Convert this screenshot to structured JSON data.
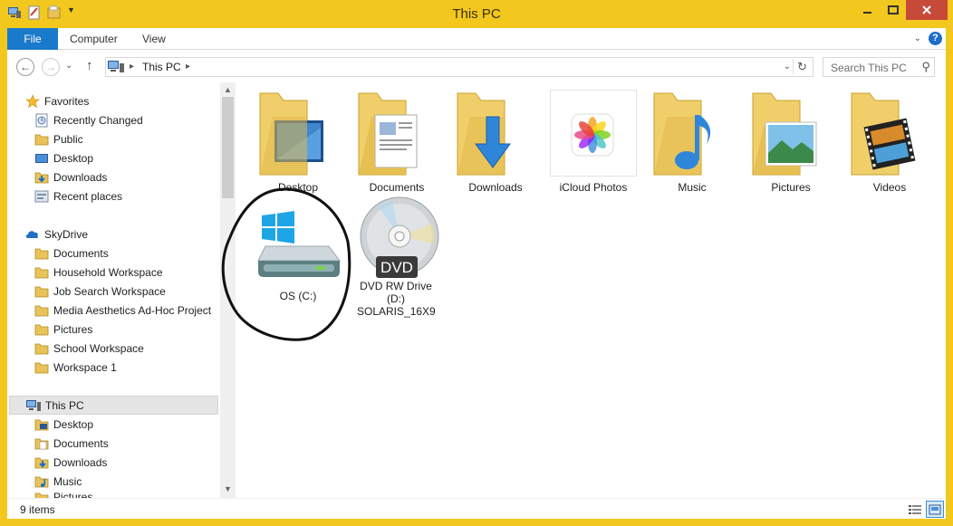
{
  "window": {
    "title": "This PC"
  },
  "ribbon": {
    "tabs": [
      "File",
      "Computer",
      "View"
    ]
  },
  "address": {
    "location": "This PC"
  },
  "search": {
    "placeholder": "Search This PC"
  },
  "nav": {
    "favorites": {
      "label": "Favorites",
      "items": [
        "Recently Changed",
        "Public",
        "Desktop",
        "Downloads",
        "Recent places"
      ]
    },
    "skydrive": {
      "label": "SkyDrive",
      "items": [
        "Documents",
        "Household Workspace",
        "Job Search Workspace",
        "Media Aesthetics Ad-Hoc Project",
        "Pictures",
        "School Workspace",
        "Workspace 1"
      ]
    },
    "thispc": {
      "label": "This PC",
      "items": [
        "Desktop",
        "Documents",
        "Downloads",
        "Music",
        "Pictures"
      ]
    }
  },
  "folders": [
    "Desktop",
    "Documents",
    "Downloads",
    "iCloud Photos",
    "Music",
    "Pictures",
    "Videos"
  ],
  "drives": {
    "c": {
      "name": "OS (C:)"
    },
    "d": {
      "name": "DVD RW Drive (D:) SOLARIS_16X9",
      "badge": "DVD"
    }
  },
  "status": {
    "items": "9 items"
  },
  "colors": {
    "frame": "#f2c81e",
    "file_tab": "#1979ca",
    "close": "#c7493a"
  }
}
